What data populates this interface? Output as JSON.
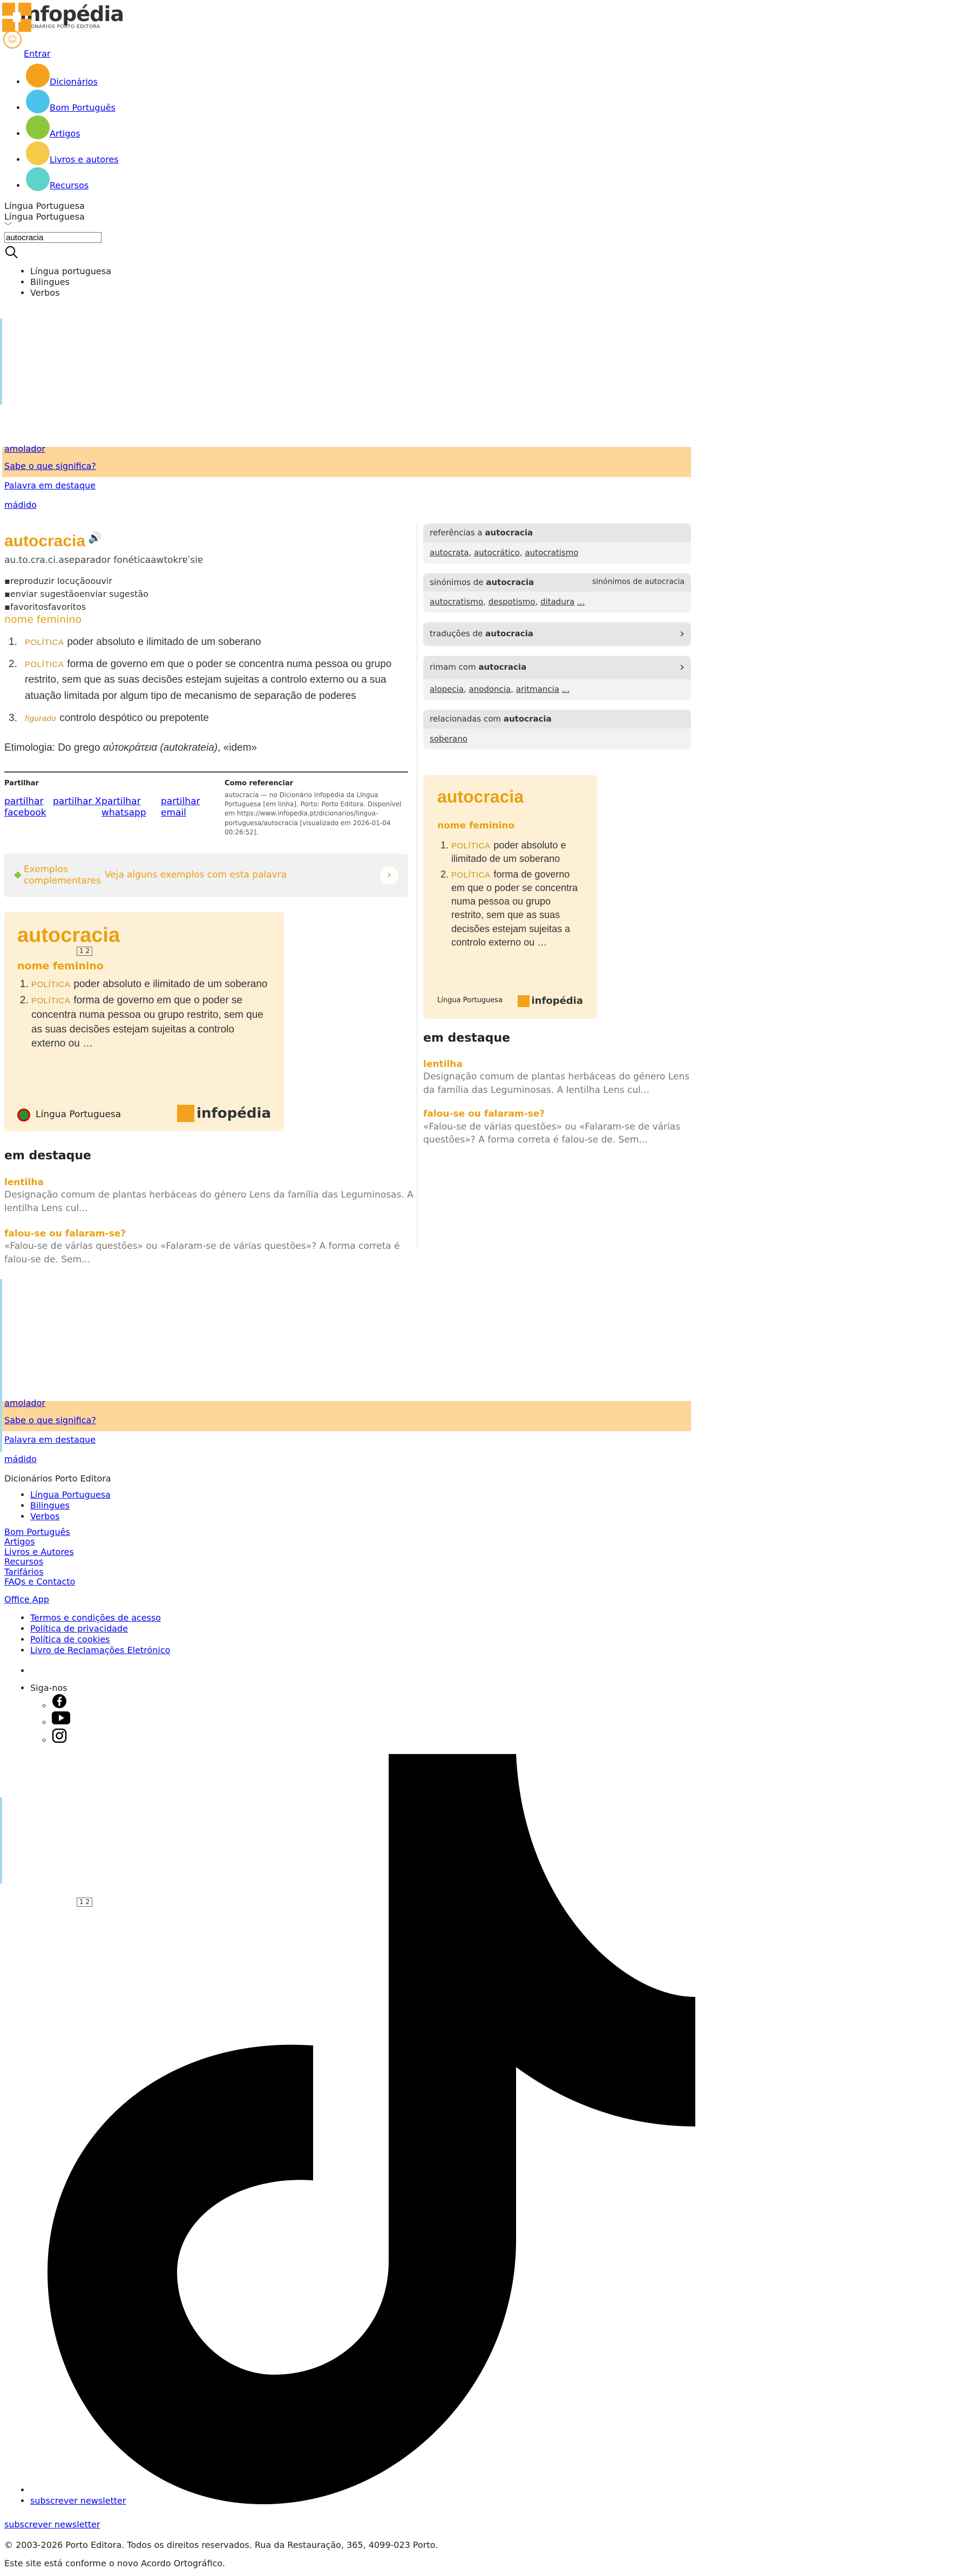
{
  "header": {
    "logo_text": "infopédia",
    "logo_sub": "DICIONÁRIOS PORTO EDITORA",
    "login": "Entrar",
    "nav": [
      {
        "label": "Dicionários",
        "color": "#f4a21d"
      },
      {
        "label": "Bom Português",
        "color": "#4cc3ea"
      },
      {
        "label": "Artigos",
        "color": "#8cc63f"
      },
      {
        "label": "Livros e autores",
        "color": "#f7c948"
      },
      {
        "label": "Recursos",
        "color": "#5fd3c9"
      }
    ]
  },
  "search": {
    "dict_selected": "Língua Portuguesa",
    "dict_option": "Língua Portuguesa",
    "query": "autocracia",
    "dict_list": [
      "Língua portuguesa",
      "Bilingues",
      "Verbos"
    ]
  },
  "promo": {
    "word": "amolador",
    "question": "Sabe o que significa?",
    "featured_label": "Palavra em destaque",
    "featured_word": "mádido"
  },
  "entry": {
    "word": "autocracia",
    "syllables": "au.to.cra.ci.a",
    "separator_alt": "separador fonética",
    "phonetic": "awtokrɐˈsiɐ",
    "listen_alt": "reproduzir locução",
    "listen_label": "ouvir",
    "suggest_alt": "enviar sugestão",
    "suggest_label": "enviar sugestão",
    "fav_alt": "favoritos",
    "fav_label": "favoritos",
    "pos": "nome feminino",
    "definitions": [
      {
        "num": "1.",
        "tag": "POLÍTICA",
        "text": "poder absoluto e ilimitado de um soberano"
      },
      {
        "num": "2.",
        "tag": "POLÍTICA",
        "text": "forma de governo em que o poder se concentra numa pessoa ou grupo restrito, sem que as suas decisões estejam sujeitas a controlo externo ou a sua atuação limitada por algum tipo de mecanismo de separação de poderes"
      },
      {
        "num": "3.",
        "tag": "figurado",
        "text": "controlo despótico ou prepotente"
      }
    ],
    "etymology_prefix": "Etimologia: Do grego",
    "etymology_greek": "αὐτοκράτεια",
    "etymology_translit": "(autokrateia)",
    "etymology_suffix": ", «idem»"
  },
  "share": {
    "title": "Partilhar",
    "links": [
      "partilhar facebook",
      "partilhar X",
      "partilhar whatsapp",
      "partilhar email"
    ],
    "cite_title": "Como referenciar",
    "cite_text": "autocracia — no Dicionário Infopédia da Língua Portuguesa [em linha]. Porto: Porto Editora. Disponível em https://www.infopedia.pt/dicionarios/lingua-portuguesa/autocracia [visualizado em 2026-01-04 00:26:52]."
  },
  "examples": {
    "label": "Exemplos complementares",
    "link": "Veja alguns exemplos com esta palavra"
  },
  "card": {
    "word": "autocracia",
    "pager": "1 2",
    "pos": "nome feminino",
    "defs": [
      {
        "tag": "POLÍTICA",
        "text": "poder absoluto e ilimitado de um soberano"
      },
      {
        "tag": "POLÍTICA",
        "text": "forma de governo em que o poder se concentra numa pessoa ou grupo restrito, sem que as suas decisões estejam sujeitas a controlo externo ou …"
      }
    ],
    "lang": "Língua Portuguesa",
    "brand": "infopédia"
  },
  "right_card": {
    "word": "autocracia",
    "pos": "nome feminino",
    "defs": [
      {
        "tag": "POLÍTICA",
        "text": "poder absoluto e ilimitado de um soberano"
      },
      {
        "tag": "POLÍTICA",
        "text": "forma de governo em que o poder se concentra numa pessoa ou grupo restrito, sem que as suas decisões estejam sujeitas a controlo externo ou …"
      }
    ],
    "lang": "Língua Portuguesa",
    "brand": "infopédia"
  },
  "featured": {
    "title": "em destaque",
    "items": [
      {
        "title": "lentilha",
        "text": "Designação comum de plantas herbáceas do género Lens da família das Leguminosas. A lentilha Lens cul..."
      },
      {
        "title": "falou-se ou falaram-se?",
        "text": "«Falou-se de várias questões» ou «Falaram-se de várias questões»? A forma correta é falou-se de. Sem..."
      }
    ]
  },
  "related": {
    "refs_label": "referências a",
    "refs_word": "autocracia",
    "refs": [
      "autocrata",
      "autocrático",
      "autocratismo"
    ],
    "syn_label": "sinónimos de",
    "syn_word": "autocracia",
    "syn_img_alt": "sinónimos de autocracia",
    "syns": [
      "autocratismo",
      "despotismo",
      "ditadura"
    ],
    "syns_more": "...",
    "trans_label": "traduções de",
    "trans_word": "autocracia",
    "rhyme_label": "rimam com",
    "rhyme_word": "autocracia",
    "rhymes": [
      "alopecia",
      "anodoncia",
      "aritmancia"
    ],
    "rhymes_more": "...",
    "rel_label": "relacionadas com",
    "rel_word": "autocracia",
    "rels": [
      "soberano"
    ]
  },
  "footer": {
    "brand": "Dicionários Porto Editora",
    "dicts": [
      "Língua Portuguesa",
      "Bilingues",
      "Verbos"
    ],
    "links": [
      "Bom Português",
      "Artigos",
      "Livros e Autores",
      "Recursos",
      "Tarifários",
      "FAQs e Contacto"
    ],
    "office": "Office App",
    "legal": [
      "Termos e condições de acesso",
      "Política de privacidade",
      "Política de cookies",
      "Livro de Reclamações Eletrónico"
    ],
    "follow": "Siga-nos",
    "newsletter_item": "subscrever newsletter",
    "newsletter": "subscrever newsletter",
    "copyright": "© 2003-2026 Porto Editora. Todos os direitos reservados. Rua da Restauração, 365, 4099-023 Porto.",
    "ortho": "Este site está conforme o novo Acordo Ortográfico."
  }
}
